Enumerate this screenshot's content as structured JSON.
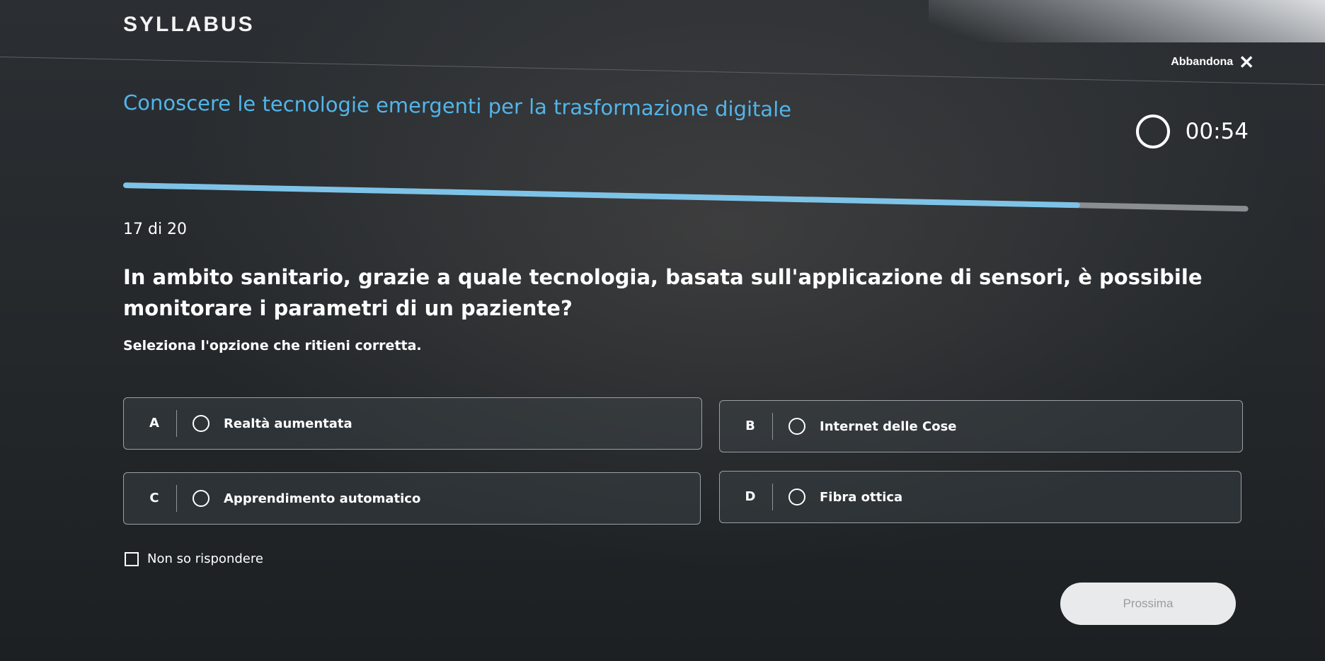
{
  "header": {
    "logo_text": "SYLLABUS",
    "leave_label": "Abbandona"
  },
  "quiz": {
    "course_title": "Conoscere le tecnologie emergenti per la trasformazione digitale",
    "timer": "00:54",
    "progress": {
      "current": 17,
      "total": 20,
      "percent": 85
    },
    "counter_label": "17 di 20",
    "question": "In ambito sanitario, grazie a quale tecnologia, basata sull'applicazione di sensori, è possibile monitorare i parametri di un paziente?",
    "instruction": "Seleziona l'opzione che ritieni corretta.",
    "options": [
      {
        "letter": "A",
        "text": "Realtà aumentata"
      },
      {
        "letter": "B",
        "text": "Internet delle Cose"
      },
      {
        "letter": "C",
        "text": "Apprendimento automatico"
      },
      {
        "letter": "D",
        "text": "Fibra ottica"
      }
    ],
    "dont_know_label": "Non so rispondere",
    "next_label": "Prossima"
  },
  "icons": {
    "close": "close-icon",
    "timer": "timer-ring-icon",
    "radio": "radio-circle-icon",
    "checkbox": "checkbox-icon"
  },
  "colors": {
    "accent": "#52b5ea",
    "progress_fill": "#7dc3e8",
    "background": "#25292c"
  }
}
